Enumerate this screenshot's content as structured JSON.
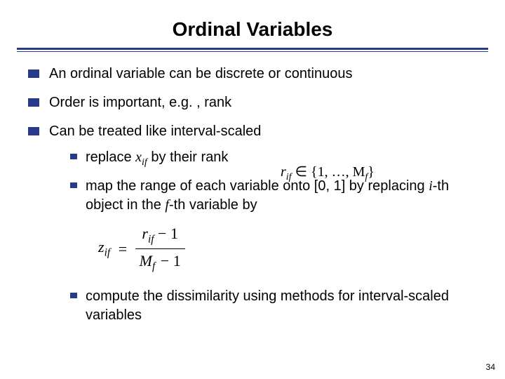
{
  "title": "Ordinal Variables",
  "bullets": {
    "b1": "An ordinal variable can be discrete or continuous",
    "b2": "Order is important, e.g. , rank",
    "b3": "Can be treated like interval-scaled",
    "b3a_pre": "replace ",
    "b3a_var": "x",
    "b3a_sub": "if",
    "b3a_post": "  by their rank",
    "range_eq_var": "r",
    "range_eq_sub": "if",
    "range_eq_rest": " ∈ {1, …, M",
    "range_eq_M_sub": "f",
    "range_eq_close": "}",
    "b3b_pre": "map the range of each variable onto [0, 1] by replacing ",
    "b3b_i": "i",
    "b3b_mid1": "-th object in the ",
    "b3b_f": "f",
    "b3b_mid2": "-th variable by",
    "formula": {
      "lhs_var": "z",
      "lhs_sub": "if",
      "num_r": "r",
      "num_r_sub": "if",
      "num_tail": " − 1",
      "den_M": "M",
      "den_M_sub": "f",
      "den_tail": " − 1"
    },
    "b3c": "compute the dissimilarity using methods for interval-scaled variables"
  },
  "page_number": "34"
}
